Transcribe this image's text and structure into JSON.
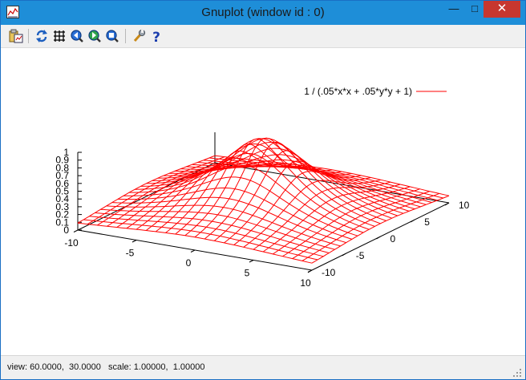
{
  "window": {
    "title": "Gnuplot (window id : 0)",
    "minimize_glyph": "—",
    "maximize_glyph": "□",
    "close_glyph": "✕"
  },
  "toolbar": {
    "items": [
      "copy-to-clipboard-icon",
      "replot-icon",
      "grid-icon",
      "zoom-previous-icon",
      "zoom-next-icon",
      "zoom-unzoom-icon",
      "options-wrench-icon",
      "help-icon"
    ]
  },
  "status": {
    "text": "view: 60.0000,  30.0000   scale: 1.00000,  1.00000"
  },
  "colors": {
    "surface": "#ff0000",
    "titlebar": "#1e8ed8",
    "close": "#c7372f"
  },
  "chart_data": {
    "type": "surface",
    "function": "1/(.05*x*x + .05*y*y + 1)",
    "legend": "1 / (.05*x*x + .05*y*y + 1)",
    "legend_position": "top-right",
    "view": [
      60,
      30
    ],
    "xrange": [
      -10,
      10
    ],
    "yrange": [
      -10,
      10
    ],
    "zrange": [
      0,
      1
    ],
    "isosamples": 25,
    "x_ticks": [
      "-10",
      "-5",
      "0",
      "5",
      "10"
    ],
    "y_ticks": [
      "-10",
      "-5",
      "0",
      "5",
      "10"
    ],
    "z_ticks": [
      "0",
      "0.1",
      "0.2",
      "0.3",
      "0.4",
      "0.5",
      "0.6",
      "0.7",
      "0.8",
      "0.9",
      "1"
    ]
  }
}
